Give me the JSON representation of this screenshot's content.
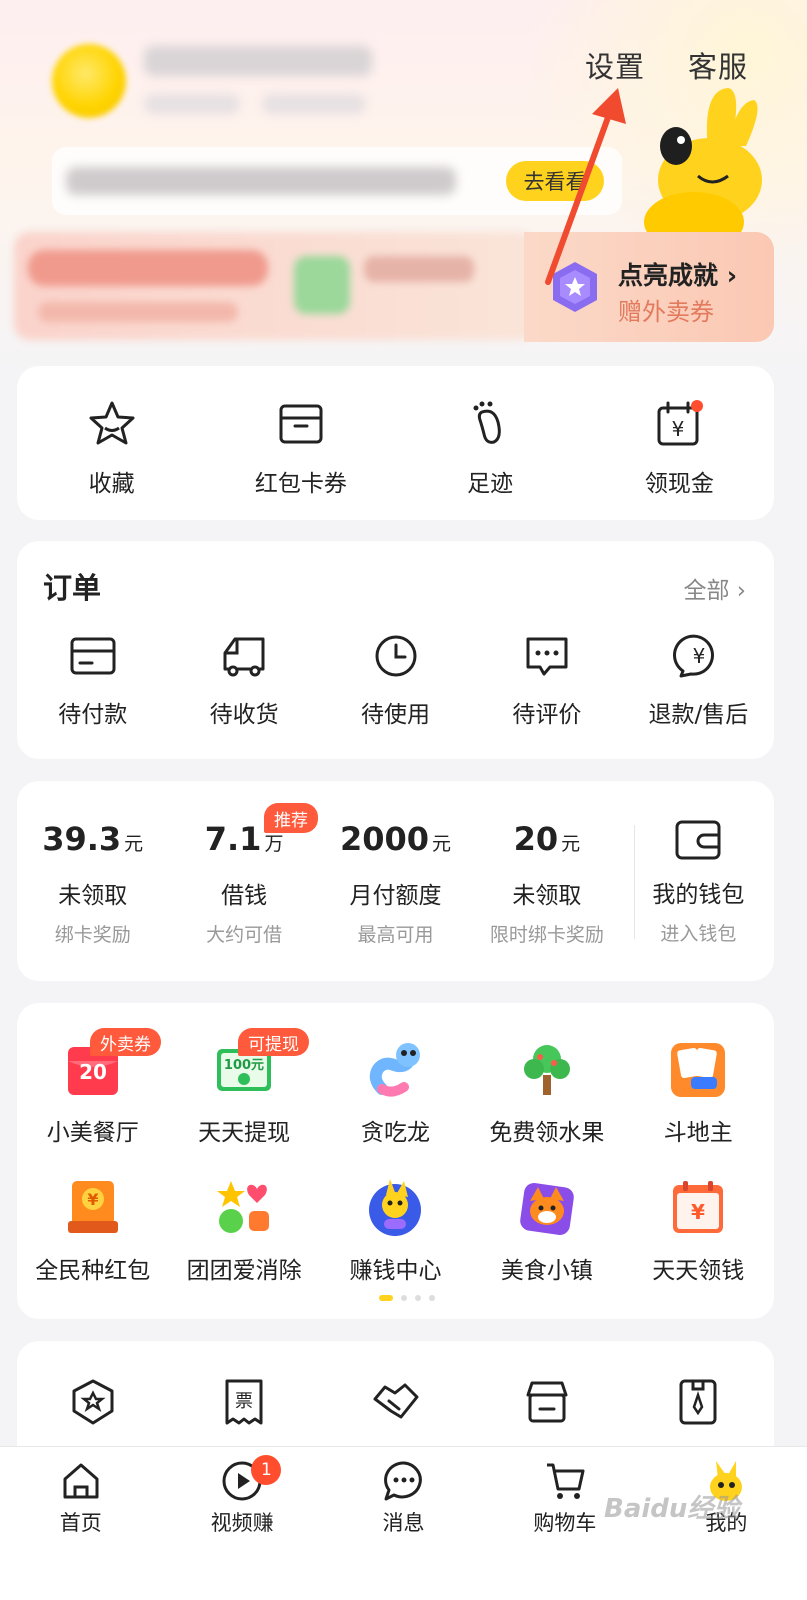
{
  "header": {
    "settings_label": "设置",
    "service_label": "客服",
    "banner_button": "去看看"
  },
  "achievement": {
    "title": "点亮成就 ›",
    "subtitle": "赠外卖券"
  },
  "quick_links": [
    {
      "label": "收藏",
      "icon": "star-icon"
    },
    {
      "label": "红包卡券",
      "icon": "wallet-card-icon"
    },
    {
      "label": "足迹",
      "icon": "footprint-icon"
    },
    {
      "label": "领现金",
      "icon": "calendar-yen-icon"
    }
  ],
  "orders": {
    "title": "订单",
    "all_label": "全部 ›",
    "items": [
      {
        "label": "待付款",
        "icon": "card-icon"
      },
      {
        "label": "待收货",
        "icon": "truck-icon"
      },
      {
        "label": "待使用",
        "icon": "clock-icon"
      },
      {
        "label": "待评价",
        "icon": "comment-icon"
      },
      {
        "label": "退款/售后",
        "icon": "refund-icon"
      }
    ]
  },
  "wallet": {
    "recommend_tag": "推荐",
    "items": [
      {
        "value": "39.3",
        "unit": "元",
        "name": "未领取",
        "sub": "绑卡奖励"
      },
      {
        "value": "7.1",
        "unit": "万",
        "name": "借钱",
        "sub": "大约可借"
      },
      {
        "value": "2000",
        "unit": "元",
        "name": "月付额度",
        "sub": "最高可用"
      },
      {
        "value": "20",
        "unit": "元",
        "name": "未领取",
        "sub": "限时绑卡奖励"
      }
    ],
    "my_wallet": {
      "name": "我的钱包",
      "sub": "进入钱包"
    }
  },
  "games": {
    "tags": {
      "waimai": "外卖券",
      "withdraw": "可提现"
    },
    "items": [
      {
        "label": "小美餐厅",
        "icon": "red-envelope-20-icon"
      },
      {
        "label": "天天提现",
        "icon": "cash-100-icon"
      },
      {
        "label": "贪吃龙",
        "icon": "snake-dragon-icon"
      },
      {
        "label": "免费领水果",
        "icon": "fruit-tree-icon"
      },
      {
        "label": "斗地主",
        "icon": "poker-cards-icon"
      },
      {
        "label": "全民种红包",
        "icon": "yen-envelope-icon"
      },
      {
        "label": "团团爱消除",
        "icon": "match-candy-icon"
      },
      {
        "label": "赚钱中心",
        "icon": "kangaroo-game-icon"
      },
      {
        "label": "美食小镇",
        "icon": "fox-chef-icon"
      },
      {
        "label": "天天领钱",
        "icon": "yen-calendar-icon"
      }
    ],
    "badge_text_20": "20",
    "badge_text_100": "100元"
  },
  "tabs": [
    {
      "label": "首页",
      "icon": "home-icon"
    },
    {
      "label": "视频赚",
      "icon": "video-play-icon",
      "badge": "1"
    },
    {
      "label": "消息",
      "icon": "chat-icon"
    },
    {
      "label": "购物车",
      "icon": "cart-icon"
    },
    {
      "label": "我的",
      "icon": "kangaroo-icon"
    }
  ],
  "watermark": "Baidu经验",
  "colors": {
    "accent": "#ffd21e",
    "badge_red": "#ff5a3c",
    "arrow_red": "#f04a2f"
  }
}
